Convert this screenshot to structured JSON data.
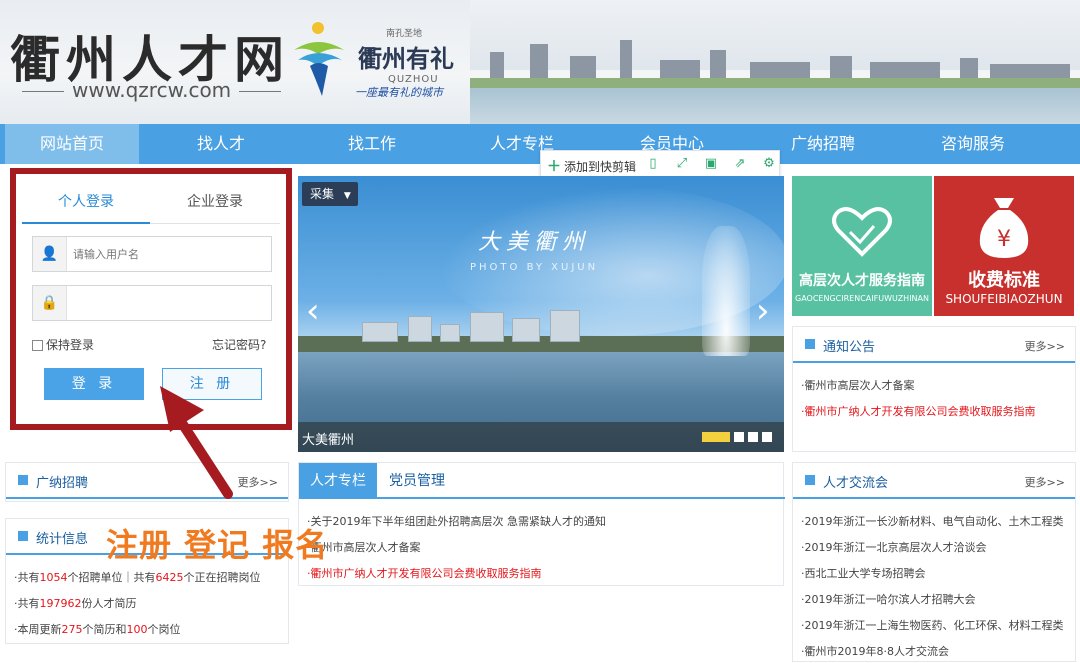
{
  "header": {
    "site_title": "衢州人才网",
    "site_url": "www.qzrcw.com",
    "quzhou_small": "南孔圣地",
    "quzhou_brand": "衢州有礼",
    "quzhou_en": "QUZHOU",
    "quzhou_slogan": "一座最有礼的城市"
  },
  "nav": {
    "items": [
      "网站首页",
      "找人才",
      "找工作",
      "人才专栏",
      "会员中心",
      "广纳招聘",
      "咨询服务"
    ],
    "active_index": 0
  },
  "toolbar": {
    "add_label": "添加到快剪辑",
    "icons": [
      "phone-icon",
      "expand-icon",
      "save-icon",
      "share-icon",
      "settings-icon"
    ]
  },
  "login": {
    "tab_personal": "个人登录",
    "tab_company": "企业登录",
    "username_placeholder": "请输入用户名",
    "password_placeholder": "",
    "remember_label": "保持登录",
    "forgot_label": "忘记密码?",
    "login_button": "登 录",
    "register_button": "注 册"
  },
  "banner": {
    "collect_label": "采集",
    "title": "大美衢州",
    "photo_by": "PHOTO BY XUJUN",
    "caption": "大美衢州",
    "slide_count": 4,
    "active_slide": 0
  },
  "tiles": {
    "green_title": "高层次人才服务指南",
    "green_sub": "GAOCENGCIRENCAIFUWUZHINAN",
    "red_title": "收费标准",
    "red_sub": "SHOUFEIBIAOZHUN"
  },
  "notice": {
    "title": "通知公告",
    "more": "更多>>",
    "items": [
      "衢州市高层次人才备案",
      "衢州市广纳人才开发有限公司会费收取服务指南"
    ]
  },
  "recruit": {
    "title": "广纳招聘",
    "more": "更多>>"
  },
  "stats": {
    "title": "统计信息",
    "l1_a": "共有",
    "l1_n1": "1054",
    "l1_b": "个招聘单位｜共有",
    "l1_n2": "6425",
    "l1_c": "个正在招聘岗位",
    "l2_a": "共有",
    "l2_n": "197962",
    "l2_b": "份人才简历",
    "l3_a": "本周更新",
    "l3_n1": "275",
    "l3_b": "个简历和",
    "l3_n2": "100",
    "l3_c": "个岗位"
  },
  "center": {
    "tab_talent": "人才专栏",
    "tab_party": "党员管理",
    "items": [
      "关于2019年下半年组团赴外招聘高层次 急需紧缺人才的通知",
      "衢州市高层次人才备案",
      "衢州市广纳人才开发有限公司会费收取服务指南"
    ]
  },
  "exchange": {
    "title": "人才交流会",
    "more": "更多>>",
    "items": [
      "2019年浙江一长沙新材料、电气自动化、土木工程类",
      "2019年浙江一北京高层次人才洽谈会",
      "西北工业大学专场招聘会",
      "2019年浙江一哈尔滨人才招聘大会",
      "2019年浙江一上海生物医药、化工环保、材料工程类",
      "衢州市2019年8·8人才交流会"
    ]
  },
  "overlay_text": "注册 登记 报名",
  "colors": {
    "nav_blue": "#49a0e3",
    "highlight_red": "#a51b20",
    "overlay_orange": "#f07a1f",
    "tile_green": "#58c1a2",
    "tile_red": "#c7302d"
  }
}
